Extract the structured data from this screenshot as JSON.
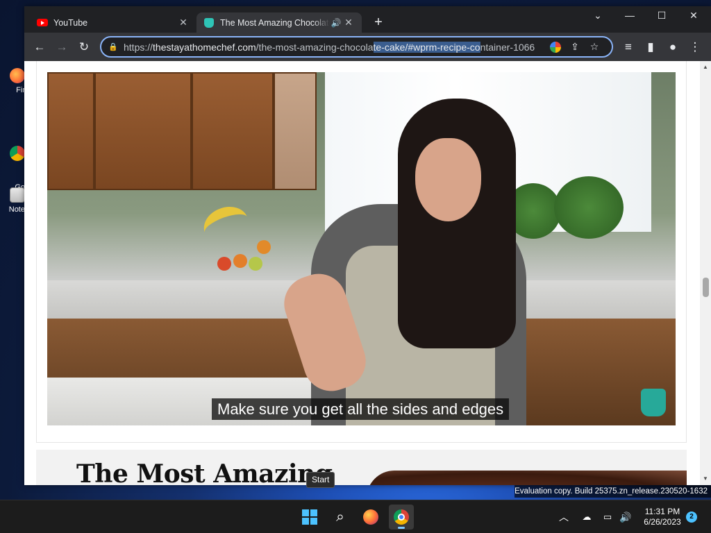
{
  "desktop": {
    "icons": [
      {
        "label": "Fir"
      },
      {
        "label": "Go\nChr"
      },
      {
        "label": "Note"
      }
    ]
  },
  "browser": {
    "tabs": [
      {
        "title": "YouTube",
        "close": "✕"
      },
      {
        "title": "The Most Amazing Chocolate",
        "audio": "🔊",
        "close": "✕"
      }
    ],
    "new_tab": "+",
    "window_controls": {
      "tab_search": "⌄",
      "minimize": "—",
      "maximize": "☐",
      "close": "✕"
    },
    "toolbar": {
      "back": "←",
      "forward": "→",
      "reload": "↻"
    },
    "address": {
      "scheme": "https://",
      "host": "thestayathomechef.com",
      "path_before_selection": "/the-most-amazing-chocola",
      "selected": "te-cake/#wprm-recipe-co",
      "path_after_selection": "ntainer-1066"
    },
    "toolbar_right": {
      "share": "⇪",
      "bookmark": "☆",
      "reading_list": "≡",
      "side_panel": "▮",
      "profile": "●",
      "menu": "⋮"
    }
  },
  "page": {
    "video": {
      "caption": "Make sure you get all the sides and edges"
    },
    "recipe_title": "The Most Amazing"
  },
  "scrollbar": {
    "up": "▲",
    "down": "▼"
  },
  "tooltip": "Start",
  "watermark": "Evaluation copy. Build 25375.zn_release.230520-1632",
  "taskbar": {
    "tray_chevron": "︿",
    "clock_time": "11:31 PM",
    "clock_date": "6/26/2023",
    "notification_count": "2"
  }
}
